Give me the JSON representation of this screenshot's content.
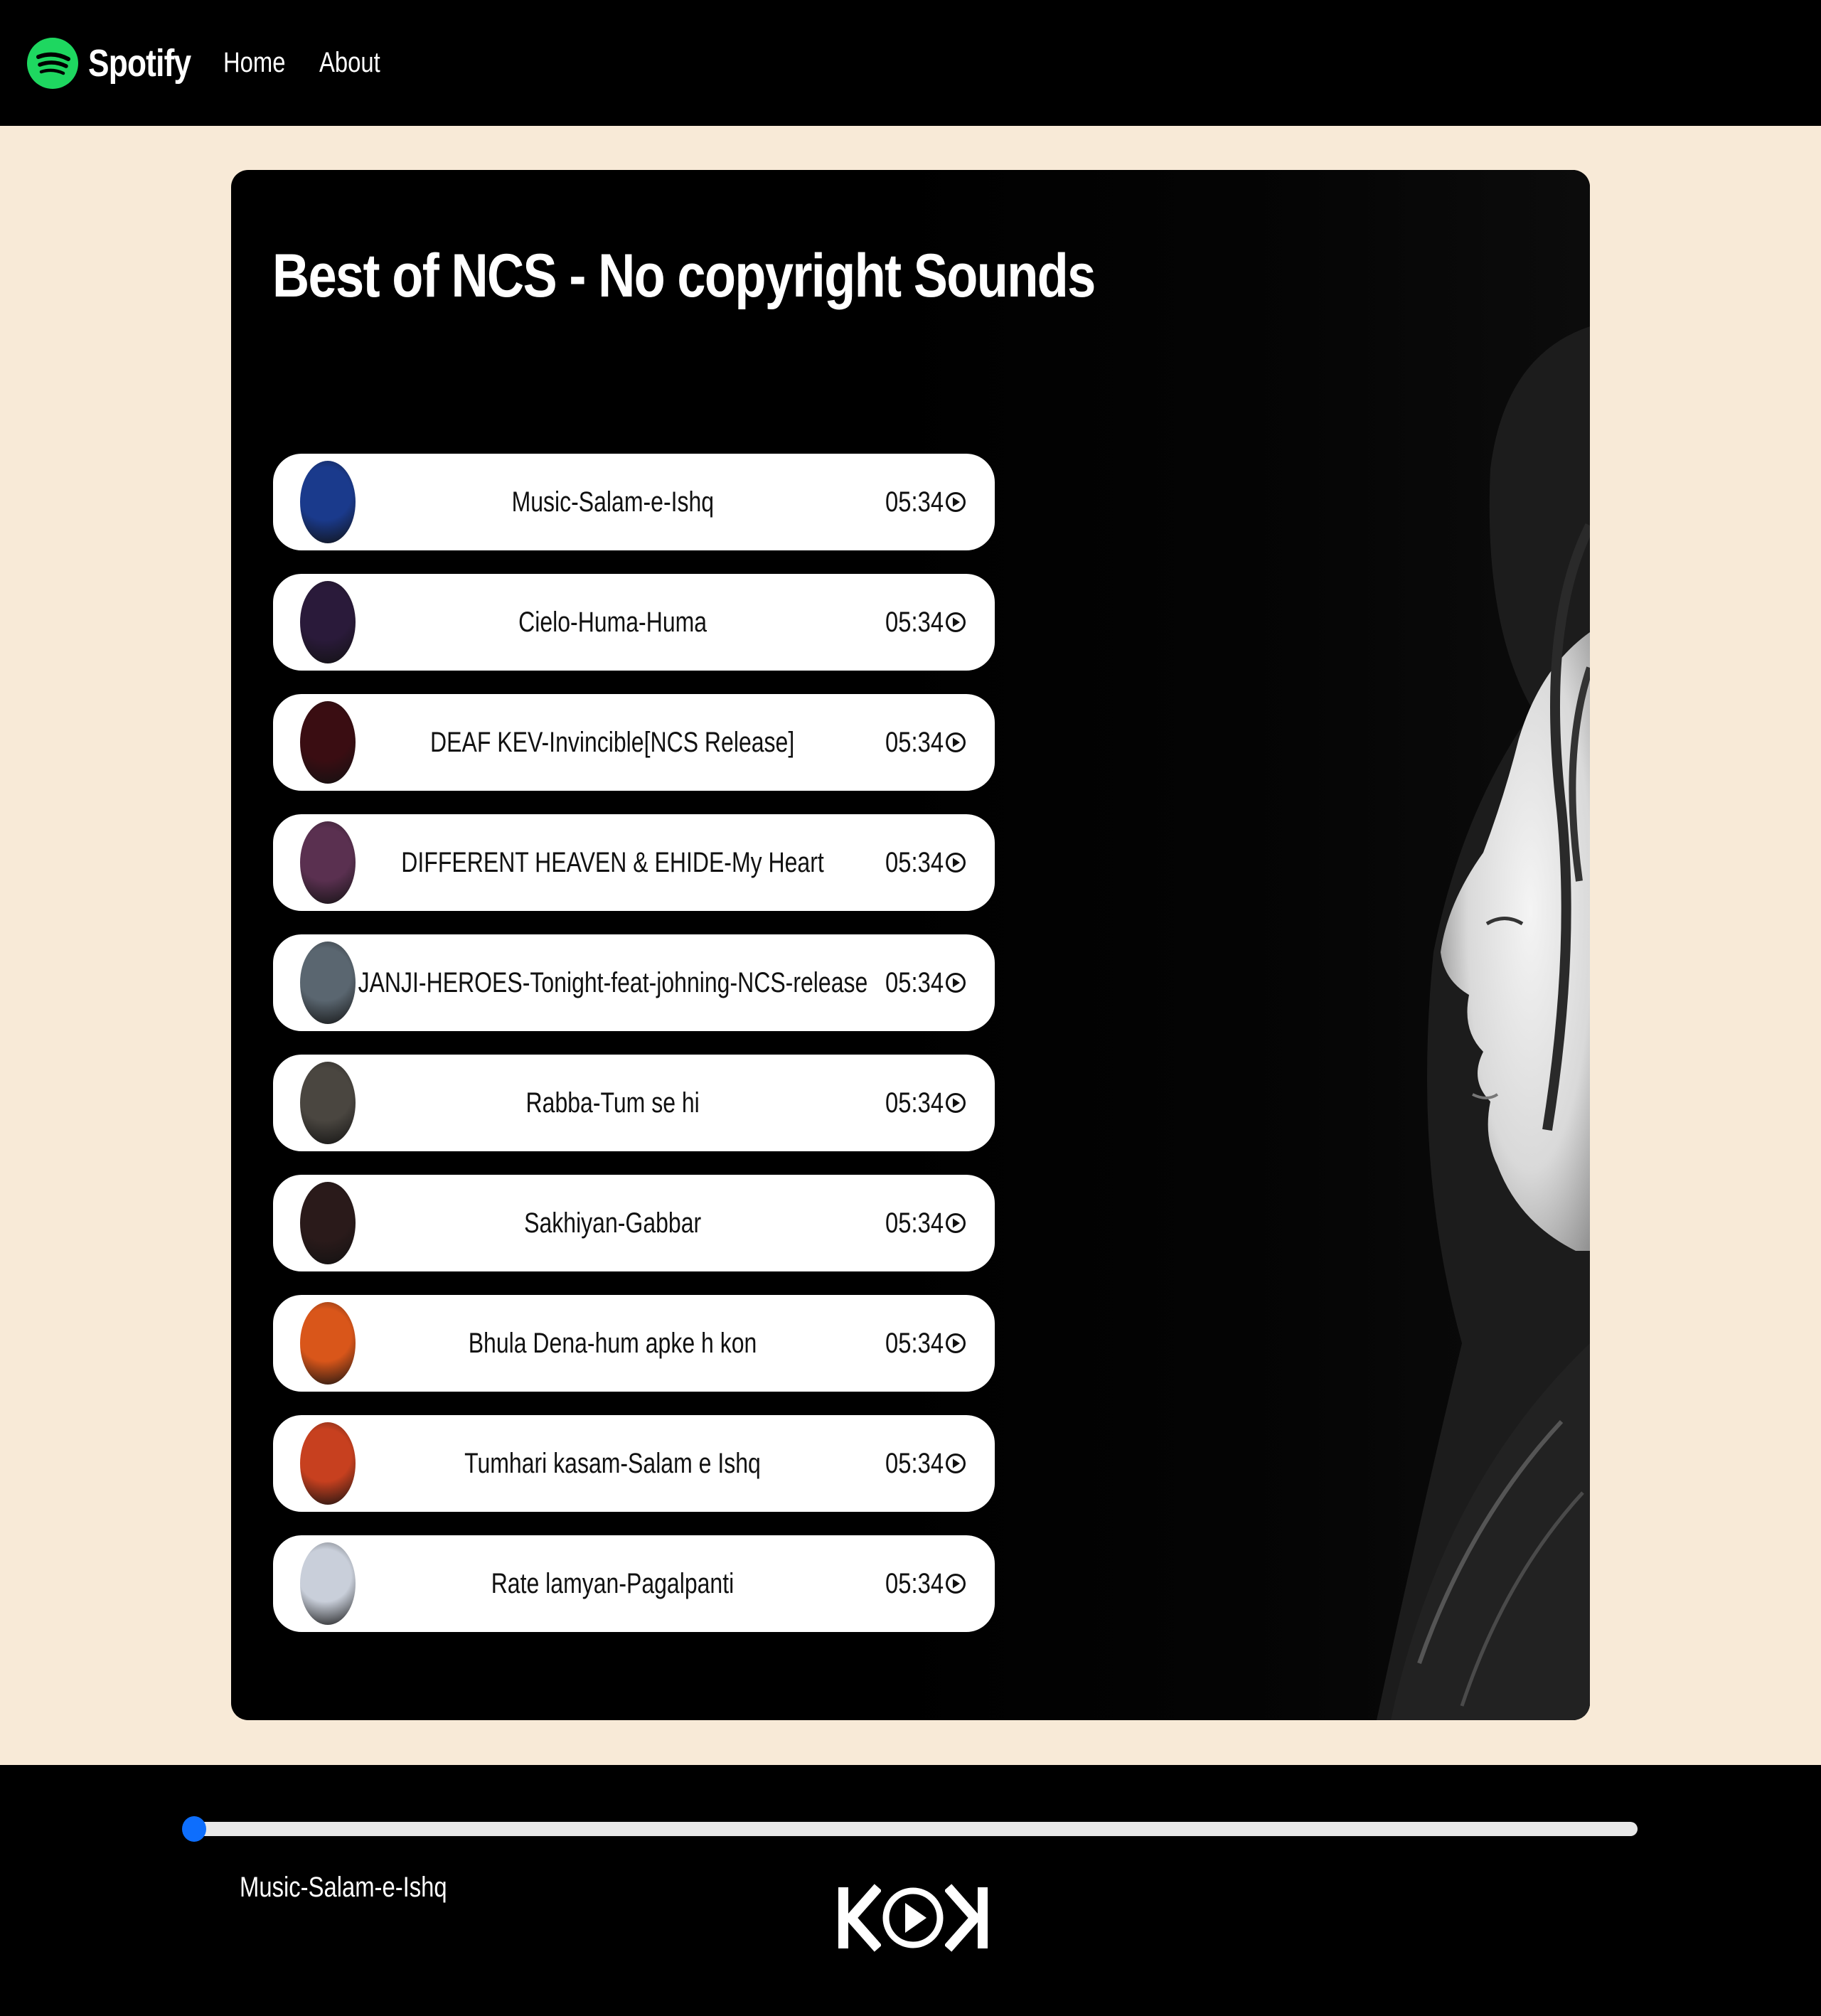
{
  "navbar": {
    "brand": "Spotify",
    "links": [
      "Home",
      "About"
    ],
    "logo_icon": "spotify-logo-icon",
    "accent": "#1ed760"
  },
  "playlist": {
    "title": "Best of NCS - No copyright Sounds",
    "songs": [
      {
        "name": "Music-Salam-e-Ishq",
        "duration": "05:34",
        "cover_color": "#1a3a8c"
      },
      {
        "name": "Cielo-Huma-Huma",
        "duration": "05:34",
        "cover_color": "#2a1a3a"
      },
      {
        "name": "DEAF KEV-Invincible[NCS Release]",
        "duration": "05:34",
        "cover_color": "#3a0d12"
      },
      {
        "name": "DIFFERENT HEAVEN & EHIDE-My Heart",
        "duration": "05:34",
        "cover_color": "#5a3050"
      },
      {
        "name": "JANJI-HEROES-Tonight-feat-johning-NCS-release",
        "duration": "05:34",
        "cover_color": "#5a6670"
      },
      {
        "name": "Rabba-Tum se hi",
        "duration": "05:34",
        "cover_color": "#4a4640"
      },
      {
        "name": "Sakhiyan-Gabbar",
        "duration": "05:34",
        "cover_color": "#2a1a1a"
      },
      {
        "name": "Bhula Dena-hum apke h kon",
        "duration": "05:34",
        "cover_color": "#d9561a"
      },
      {
        "name": "Tumhari kasam-Salam e Ishq",
        "duration": "05:34",
        "cover_color": "#c7401f"
      },
      {
        "name": "Rate lamyan-Pagalpanti",
        "duration": "05:34",
        "cover_color": "#c9cfda"
      }
    ]
  },
  "player": {
    "now_playing": "Music-Salam-e-Ishq",
    "progress": 0,
    "thumb_color": "#0d6efd",
    "controls": [
      "previous-icon",
      "play-icon",
      "next-icon"
    ]
  }
}
